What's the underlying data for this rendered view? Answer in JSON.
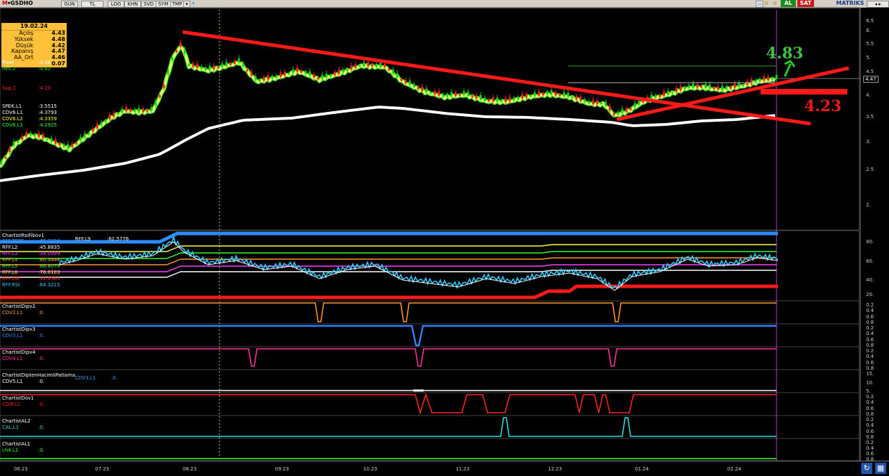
{
  "toolbar": {
    "symbol_prefix": "M",
    "symbol": "GSDHO",
    "buttons": [
      "GUN",
      "TL",
      "LOG",
      "KHN",
      "SVD",
      "SYM",
      "TMP"
    ],
    "buy_label": "AL",
    "sell_label": "SAT",
    "brand": "MATRIKS"
  },
  "info_box": {
    "date": "19.02.24",
    "rows": [
      {
        "label": "Açılış",
        "value": "4.43"
      },
      {
        "label": "Yüksek",
        "value": "4.48"
      },
      {
        "label": "Düşük",
        "value": "4.42"
      },
      {
        "label": "Kapanış",
        "value": "4.47"
      },
      {
        "label": "AA_Ort",
        "value": "4.46"
      },
      {
        "label": "",
        "value": "0.07"
      }
    ]
  },
  "price_labels": [
    {
      "name": "Pivot",
      "value": ":4.36",
      "color": "#ffffff"
    },
    {
      "name": "Res.3",
      "value": ":4.83",
      "color": "#22dd22"
    },
    {
      "name": "Sup.1",
      "value": ":4.23",
      "color": "#ff2222"
    },
    {
      "name": "SPEK.L1",
      "value": ":3.5515",
      "color": "#ffffff"
    },
    {
      "name": "CDV6.L1",
      "value": ":4.3793",
      "color": "#ffffff"
    },
    {
      "name": "CDV6.L2",
      "value": ":4.3359",
      "color": "#ffff33"
    },
    {
      "name": "CDV6.L3",
      "value": ":4.2925",
      "color": "#33ff33"
    }
  ],
  "annotations": {
    "res_value": "4.83",
    "sup_value": "4.23",
    "last_price": "4.47"
  },
  "price_axis": [
    "6.5",
    "6.",
    "5.5",
    "5.",
    "4.5",
    "4.47",
    "4.",
    "3.5",
    "3.",
    "2.5",
    "2."
  ],
  "rsi_panel": {
    "title": "ChartistRsiFibov1",
    "rff_l9_name": "RFF.L9",
    "rff_l9_value": ":62.5776",
    "lines": [
      {
        "name": "RFF.TEPE",
        "value": ":87.7324",
        "color": "#3a9cff"
      },
      {
        "name": "RFF.L2",
        "value": ":45.8835",
        "color": "#ffffff"
      },
      {
        "name": "RFF.L3",
        "value": ":54.0999",
        "color": "#ff40ff"
      },
      {
        "name": "RFF.L4",
        "value": ":60.3444",
        "color": "#ff9933"
      },
      {
        "name": "RFF.L5",
        "value": ":66.8079",
        "color": "#33ff33"
      },
      {
        "name": "RFF.L6",
        "value": ":76.0103",
        "color": "#ffff44"
      },
      {
        "name": "RFF.DIP",
        "value": ":32.9563",
        "color": "#ff2222"
      },
      {
        "name": "RFF.RSI",
        "value": ":64.3215",
        "color": "#33ccff"
      }
    ],
    "axis": [
      "80.",
      "60.",
      "40.",
      "20."
    ]
  },
  "sub_panels": [
    {
      "title": "ChartistDipv2",
      "line": "CDV2.L1",
      "value": ":0.",
      "color": "#ff9a2a",
      "axis": [
        "0.2",
        "0.4",
        "0.6",
        "0.8"
      ]
    },
    {
      "title": "ChartistDipv3",
      "line": "CDV3.L1",
      "value": ":0.",
      "color": "#2f7fff",
      "axis": [
        "0.2",
        "0.4",
        "0.6",
        "0.8"
      ]
    },
    {
      "title": "ChartistDipv4",
      "line": "CDV4.L1",
      "value": ":0.",
      "color": "#ff3399",
      "axis": [
        "0.2",
        "0.4",
        "0.6",
        "0.8"
      ]
    },
    {
      "title": "ChartistDiptenHacimliPatlama",
      "line": "CDV5.L1",
      "value": ":0.",
      "color": "#ffffff",
      "extra_name": "CDV3.L1",
      "extra_value": ":0.",
      "axis": [
        "15.",
        "10.",
        "5."
      ]
    },
    {
      "title": "ChartistDov1",
      "line": "CDIP.L1",
      "value": ":0.",
      "color": "#ff2222",
      "axis": [
        "0.2",
        "0.4",
        "0.6",
        "0.8"
      ]
    },
    {
      "title": "ChartistAL2",
      "line": "CAL.L1",
      "value": ":0.",
      "color": "#33dddd",
      "axis": [
        "0.2",
        "0.4",
        "0.6",
        "0.8"
      ]
    },
    {
      "title": "ChartistAL1",
      "line": "ch4.L1",
      "value": ":0.",
      "color": "#33ff33",
      "axis": [
        "0.2",
        "0.4",
        "0.6",
        "0.8"
      ]
    }
  ],
  "x_axis": [
    "06.23",
    "07.23",
    "08.23",
    "09.23",
    "10.23",
    "11.23",
    "12.23",
    "01.24",
    "02.24"
  ],
  "colors": {
    "ma_yellow": "#ffff44",
    "ma_green": "#44ff22",
    "ma_white": "#ffffff",
    "trend_red": "#ff1a1a",
    "toolbar_bg": "#d4d0c8",
    "info_bg": "#ffc03a"
  }
}
